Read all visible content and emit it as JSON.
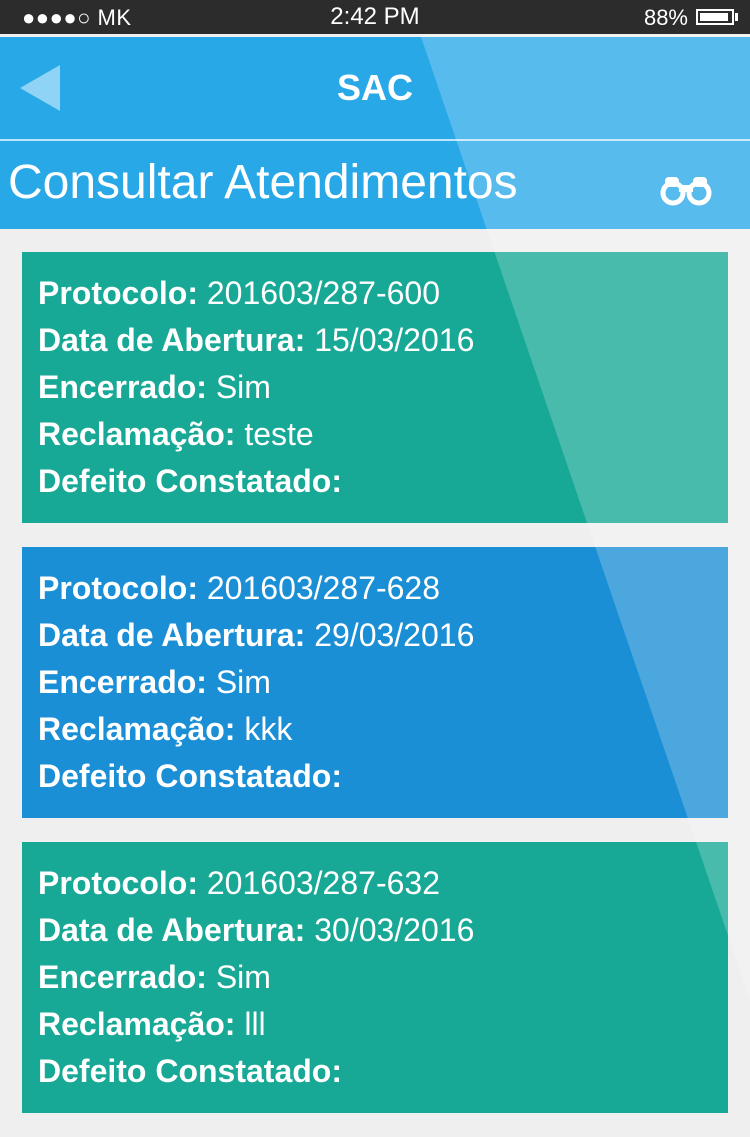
{
  "status_bar": {
    "carrier": "●●●●○ MK",
    "time": "2:42 PM",
    "battery": "88%"
  },
  "nav": {
    "title": "SAC",
    "back_icon": "back-arrow-icon"
  },
  "header": {
    "title": "Consultar Atendimentos",
    "search_icon": "binoculars-icon"
  },
  "labels": {
    "protocolo": "Protocolo:",
    "data_abertura": "Data de Abertura:",
    "encerrado": "Encerrado:",
    "reclamacao": "Reclamação:",
    "defeito": "Defeito Constatado:"
  },
  "tickets": [
    {
      "protocolo": "201603/287-600",
      "data_abertura": "15/03/2016",
      "encerrado": "Sim",
      "reclamacao": "teste",
      "defeito": "",
      "color": "#17a896"
    },
    {
      "protocolo": "201603/287-628",
      "data_abertura": "29/03/2016",
      "encerrado": "Sim",
      "reclamacao": "kkk",
      "defeito": "",
      "color": "#1b8fd6"
    },
    {
      "protocolo": "201603/287-632",
      "data_abertura": "30/03/2016",
      "encerrado": "Sim",
      "reclamacao": "lll",
      "defeito": "",
      "color": "#17a896"
    }
  ]
}
